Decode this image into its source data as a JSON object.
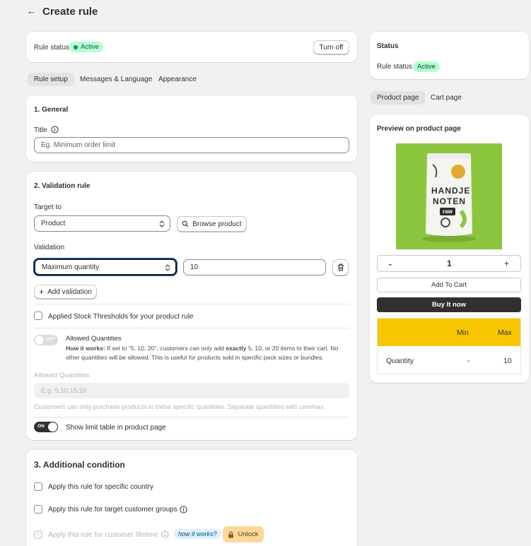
{
  "header": {
    "back_arrow": "←",
    "title": "Create rule"
  },
  "status_bar": {
    "label": "Rule status",
    "badge": "Active",
    "turn_off": "Turn off"
  },
  "tabs": [
    {
      "label": "Rule setup"
    },
    {
      "label": "Messages & Language"
    },
    {
      "label": "Appearance"
    }
  ],
  "general": {
    "heading": "1. General",
    "title_label": "Title",
    "title_placeholder": "Eg. Minimum order limit"
  },
  "validation_rule": {
    "heading": "2. Validation rule",
    "target_label": "Target to",
    "target_value": "Product",
    "browse_button": "Browse product",
    "validation_label": "Validation",
    "validation_type": "Maximum quantity",
    "validation_value": "10",
    "add_validation": "Add validation",
    "stock_thresholds": "Applied Stock Thresholds for your product rule",
    "allowed_toggle_text": "OFF",
    "allowed_title": "Allowed Quantities",
    "how_prefix": "How it works:",
    "how_text_1": " If set to \"5, 10, 20\", customers can only add ",
    "how_bold": "exactly",
    "how_text_2": " 5, 10, or 20 items to their cart. No other quantities will be allowed. This is useful for products sold in specific pack sizes or bundles.",
    "allowed_field_label": "Allowed Quantities",
    "allowed_placeholder": "E.g. 5,10,15,20",
    "allowed_help": "Customers can only purchase products in these specific quantities. Separate quantities with commas.",
    "limit_toggle_text": "ON",
    "show_limit_table": "Show limit table in product page"
  },
  "additional": {
    "heading": "3. Additional condition",
    "specific_country": "Apply this rule for specific country",
    "customer_groups": "Apply this rule for target customer groups",
    "customer_lifetime": "Apply this rule for customer lifetime",
    "how_it_works": "how it works?",
    "unlock": "Unlock"
  },
  "status_panel": {
    "heading": "Status",
    "label": "Rule status",
    "badge": "Active"
  },
  "preview_tabs": [
    {
      "label": "Product page"
    },
    {
      "label": "Cart page"
    }
  ],
  "preview": {
    "heading": "Preview on product page",
    "product_text_1": "HANDJE",
    "product_text_2": "NOTEN",
    "product_text_3": "raw",
    "minus": "-",
    "qty": "1",
    "plus": "+",
    "add_to_cart": "Add To Cart",
    "buy_now": "Buy It now",
    "table": {
      "col_min": "Min",
      "col_max": "Max",
      "row_label": "Quantity",
      "row_min": "-",
      "row_max": "10"
    }
  },
  "colors": {
    "accent_green": "#b4fed2",
    "buy_button": "#303030",
    "table_header": "#f7c600",
    "product_bg": "#8cc63f"
  }
}
